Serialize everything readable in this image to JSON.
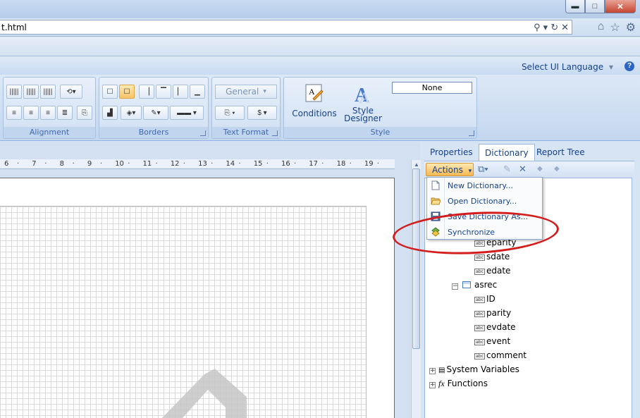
{
  "browser": {
    "url_text": "t.html",
    "window_buttons": [
      {
        "name": "minimize-button",
        "glyph": "▬"
      },
      {
        "name": "maximize-button",
        "glyph": "□"
      },
      {
        "name": "close-button",
        "glyph": "✕"
      }
    ],
    "url_tools": [
      {
        "name": "search-icon",
        "glyph": "⚲"
      },
      {
        "name": "dropdown-icon",
        "glyph": "▾"
      },
      {
        "name": "refresh-icon",
        "glyph": "↻"
      },
      {
        "name": "stop-icon",
        "glyph": "✕"
      }
    ],
    "nav_icons": [
      {
        "name": "home-icon",
        "glyph": "⌂"
      },
      {
        "name": "favorites-icon",
        "glyph": "☆"
      },
      {
        "name": "settings-icon",
        "glyph": "⚙"
      }
    ]
  },
  "header": {
    "language_label": "Select UI Language",
    "language_arrow": "▾",
    "help_glyph": "?"
  },
  "ribbon": {
    "groups": {
      "alignment": "Alignment",
      "borders": "Borders",
      "text_format": "Text Format",
      "style": "Style"
    },
    "text_format_combo": "General",
    "style_combo": "None",
    "conditions_label": "Conditions",
    "style_designer_label_1": "Style",
    "style_designer_label_2": "Designer"
  },
  "ruler": {
    "numbers": [
      "6",
      "7",
      "8",
      "9",
      "10",
      "11",
      "12",
      "13",
      "14",
      "15",
      "16",
      "17",
      "18",
      "19"
    ]
  },
  "panel": {
    "tabs": [
      "Properties",
      "Dictionary",
      "Report Tree"
    ],
    "active_tab": "Dictionary",
    "actions_label": "Actions"
  },
  "menu": {
    "items": [
      {
        "label": "New Dictionary...",
        "icon": "new-document-icon"
      },
      {
        "label": "Open Dictionary...",
        "icon": "open-folder-icon"
      },
      {
        "label": "Save Dictionary As...",
        "icon": "save-icon"
      },
      {
        "label": "Synchronize",
        "icon": "synchronize-icon"
      }
    ]
  },
  "tree": {
    "fields_top": [
      "eparity",
      "sdate",
      "edate"
    ],
    "table_name": "asrec",
    "table_fields": [
      "ID",
      "parity",
      "evdate",
      "event",
      "comment"
    ],
    "system_variables": "System Variables",
    "functions": "Functions"
  }
}
